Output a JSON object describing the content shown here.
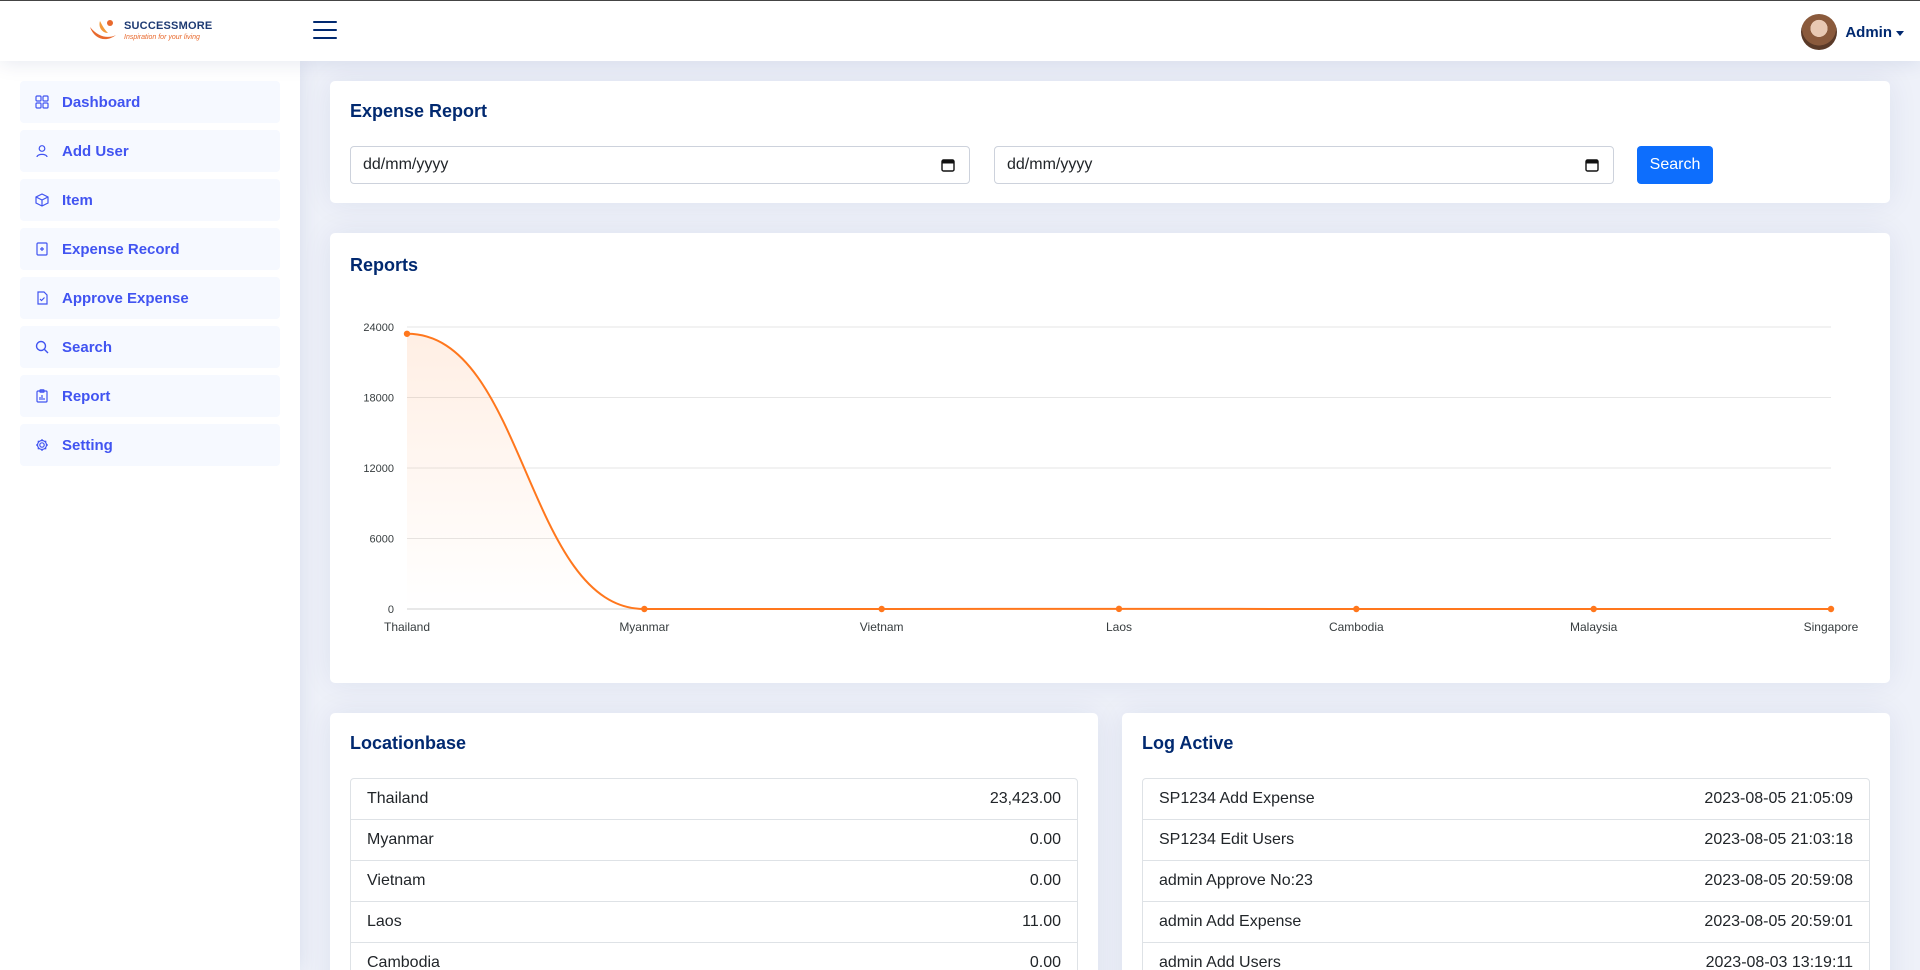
{
  "brand": {
    "name": "SUCCESSMORE",
    "tagline": "Inspiration for your living"
  },
  "user": {
    "name": "Admin"
  },
  "sidebar": {
    "items": [
      {
        "label": "Dashboard",
        "icon": "grid-icon"
      },
      {
        "label": "Add User",
        "icon": "person-icon"
      },
      {
        "label": "Item",
        "icon": "box-icon"
      },
      {
        "label": "Expense Record",
        "icon": "file-plus-icon"
      },
      {
        "label": "Approve Expense",
        "icon": "file-check-icon"
      },
      {
        "label": "Search",
        "icon": "search-icon"
      },
      {
        "label": "Report",
        "icon": "clipboard-chart-icon"
      },
      {
        "label": "Setting",
        "icon": "gear-icon"
      }
    ]
  },
  "expense_report": {
    "title": "Expense Report",
    "start_date_placeholder": "dd/mm/yyyy",
    "end_date_placeholder": "dd/mm/yyyy",
    "search_label": "Search"
  },
  "reports": {
    "title": "Reports"
  },
  "chart_data": {
    "type": "area",
    "categories": [
      "Thailand",
      "Myanmar",
      "Vietnam",
      "Laos",
      "Cambodia",
      "Malaysia",
      "Singapore"
    ],
    "values": [
      23423,
      0,
      0,
      11,
      0,
      0,
      0
    ],
    "ylim": [
      0,
      24000
    ],
    "yticks": [
      0,
      6000,
      12000,
      18000,
      24000
    ],
    "grid": true,
    "colors": {
      "line": "#ff771d",
      "fill": "#ff771d"
    }
  },
  "locationbase": {
    "title": "Locationbase",
    "rows": [
      {
        "name": "Thailand",
        "value": "23,423.00"
      },
      {
        "name": "Myanmar",
        "value": "0.00"
      },
      {
        "name": "Vietnam",
        "value": "0.00"
      },
      {
        "name": "Laos",
        "value": "11.00"
      },
      {
        "name": "Cambodia",
        "value": "0.00"
      }
    ]
  },
  "log_active": {
    "title": "Log Active",
    "rows": [
      {
        "action": "SP1234 Add Expense",
        "time": "2023-08-05 21:05:09"
      },
      {
        "action": "SP1234 Edit Users",
        "time": "2023-08-05 21:03:18"
      },
      {
        "action": "admin Approve No:23",
        "time": "2023-08-05 20:59:08"
      },
      {
        "action": "admin Add Expense",
        "time": "2023-08-05 20:59:01"
      },
      {
        "action": "admin Add Users",
        "time": "2023-08-03 13:19:11"
      }
    ]
  },
  "colors": {
    "primary": "#4154f1",
    "navy": "#012970",
    "button": "#0d6efd",
    "accent": "#ff771d"
  }
}
